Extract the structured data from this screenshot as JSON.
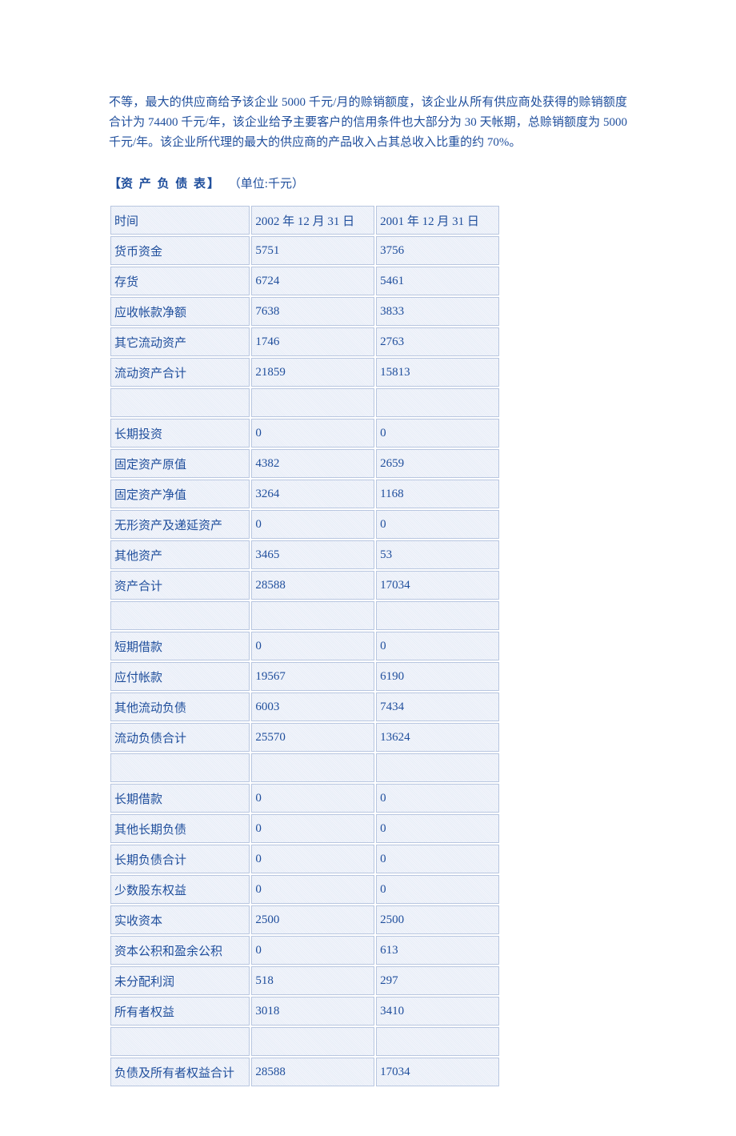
{
  "paragraph": "不等，最大的供应商给予该企业 5000 千元/月的赊销额度，该企业从所有供应商处获得的赊销额度合计为 74400 千元/年，该企业给予主要客户的信用条件也大部分为 30 天帐期，总赊销额度为 5000 千元/年。该企业所代理的最大的供应商的产品收入占其总收入比重的约 70%。",
  "table_title": "资  产  负  债  表",
  "table_unit": "（单位:千元）",
  "headers": {
    "time": "时间",
    "col1": "2002 年 12 月 31 日",
    "col2": "2001 年 12 月 31 日"
  },
  "rows": [
    {
      "label": "货币资金",
      "v1": "5751",
      "v2": "3756"
    },
    {
      "label": "存货",
      "v1": "6724",
      "v2": "5461"
    },
    {
      "label": "应收帐款净额",
      "v1": "7638",
      "v2": "3833"
    },
    {
      "label": "其它流动资产",
      "v1": "1746",
      "v2": "2763"
    },
    {
      "label": "流动资产合计",
      "v1": "21859",
      "v2": "15813"
    },
    {
      "spacer": true
    },
    {
      "label": "长期投资",
      "v1": "0",
      "v2": "0"
    },
    {
      "label": "固定资产原值",
      "v1": "4382",
      "v2": "2659"
    },
    {
      "label": "固定资产净值",
      "v1": "3264",
      "v2": "1168"
    },
    {
      "label": "无形资产及递延资产",
      "v1": "0",
      "v2": "0"
    },
    {
      "label": "其他资产",
      "v1": "3465",
      "v2": "53"
    },
    {
      "label": "资产合计",
      "v1": "28588",
      "v2": "17034"
    },
    {
      "spacer": true
    },
    {
      "label": "短期借款",
      "v1": "0",
      "v2": "0"
    },
    {
      "label": "应付帐款",
      "v1": "19567",
      "v2": "6190"
    },
    {
      "label": "其他流动负债",
      "v1": "6003",
      "v2": "7434"
    },
    {
      "label": "流动负债合计",
      "v1": "25570",
      "v2": "13624"
    },
    {
      "spacer": true
    },
    {
      "label": "长期借款",
      "v1": "0",
      "v2": "0"
    },
    {
      "label": "其他长期负债",
      "v1": "0",
      "v2": "0"
    },
    {
      "label": "长期负债合计",
      "v1": "0",
      "v2": "0"
    },
    {
      "label": "少数股东权益",
      "v1": "0",
      "v2": "0"
    },
    {
      "label": "实收资本",
      "v1": "2500",
      "v2": "2500"
    },
    {
      "label": "资本公积和盈余公积",
      "v1": "0",
      "v2": "613"
    },
    {
      "label": "未分配利润",
      "v1": "518",
      "v2": "297"
    },
    {
      "label": "所有者权益",
      "v1": "3018",
      "v2": "3410"
    },
    {
      "spacer": true
    },
    {
      "label": "负债及所有者权益合计",
      "v1": "28588",
      "v2": "17034"
    }
  ]
}
